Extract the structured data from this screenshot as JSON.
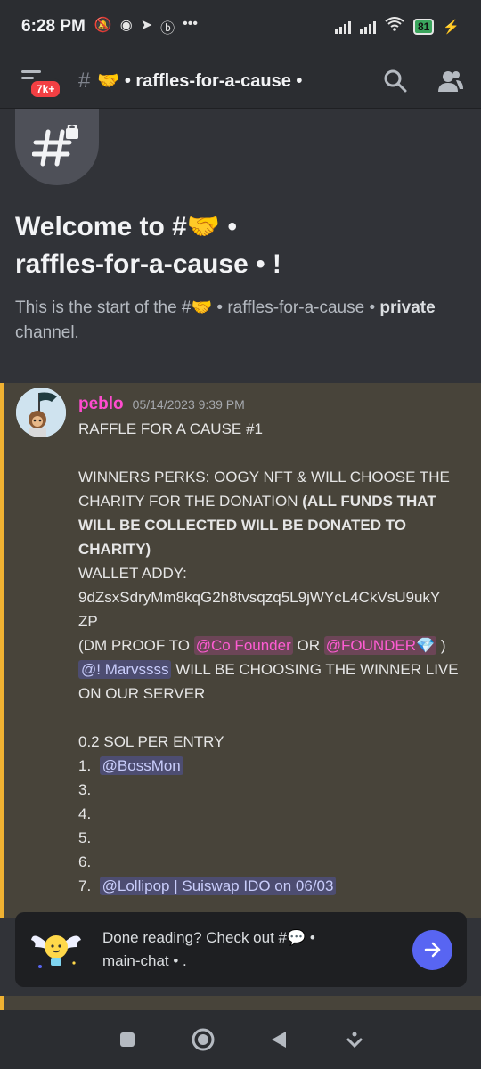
{
  "status": {
    "time": "6:28 PM",
    "battery": "81"
  },
  "header": {
    "badge": "7k+",
    "channel_title": "🤝 • raffles-for-a-cause •",
    "icons": [
      "menu-icon",
      "hash-lock-icon",
      "search-icon",
      "members-icon"
    ]
  },
  "welcome": {
    "title_line1": "Welcome to #🤝 •",
    "title_line2": "raffles-for-a-cause • !",
    "subtitle_part1": "This is the start of the #🤝 • raffles-for-a-cause •",
    "subtitle_bold": "private",
    "subtitle_part2": " channel."
  },
  "message": {
    "author": "peblo",
    "timestamp": "05/14/2023 9:39 PM",
    "title": "RAFFLE FOR A CAUSE #1",
    "perks_line1": "WINNERS PERKS: OOGY NFT & WILL CHOOSE THE",
    "perks_line2a": "CHARITY FOR THE DONATION ",
    "perks_line2b": "(ALL FUNDS THAT",
    "perks_line3": "WILL BE COLLECTED WILL BE DONATED TO",
    "perks_line4": "CHARITY)",
    "wallet_label": "WALLET ADDY:",
    "wallet_line1": "9dZsxSdryMm8kqG2h8tvsqzq5L9jWYcL4CkVsU9ukY",
    "wallet_line2": "ZP",
    "dm_prefix": " (DM PROOF TO ",
    "mention_cofounder": "@Co Founder",
    "dm_or": "  OR ",
    "mention_founder": "@FOUNDER💎",
    "dm_suffix": " )",
    "mention_marv": "@! Marvssss",
    "choose_line1": "  WILL BE CHOOSING THE WINNER LIVE",
    "choose_line2": "ON OUR SERVER",
    "price": "0.2 SOL PER ENTRY",
    "entries": [
      {
        "num": "1.",
        "mention": "@BossMon"
      },
      {
        "num": "3.",
        "mention": ""
      },
      {
        "num": "4.",
        "mention": ""
      },
      {
        "num": "5.",
        "mention": ""
      },
      {
        "num": "6.",
        "mention": ""
      },
      {
        "num": "7.",
        "mention": "@Lollipop | Suiswap IDO on 06/03"
      }
    ]
  },
  "banner": {
    "line1": "Done reading? Check out #💬 •",
    "line2": "main-chat • ."
  },
  "colors": {
    "accent": "#5865f2",
    "highlight_bar": "#f0b232",
    "author": "#ff4ccf"
  }
}
